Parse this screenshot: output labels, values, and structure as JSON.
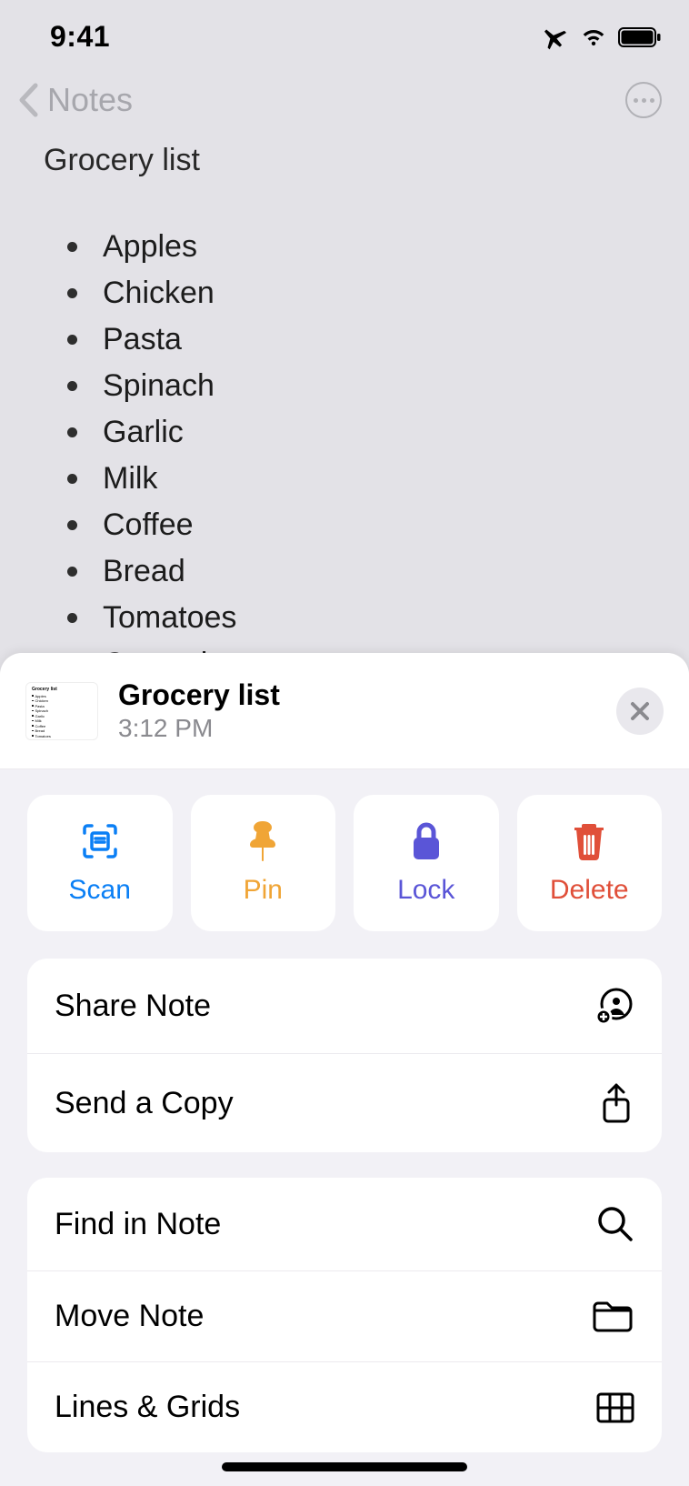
{
  "status": {
    "time": "9:41"
  },
  "nav": {
    "back_label": "Notes"
  },
  "note": {
    "title": "Grocery list",
    "items": [
      "Apples",
      "Chicken",
      "Pasta",
      "Spinach",
      "Garlic",
      "Milk",
      "Coffee",
      "Bread",
      "Tomatoes",
      "Cucumbers"
    ]
  },
  "sheet": {
    "title": "Grocery list",
    "subtitle": "3:12 PM",
    "quick": {
      "scan": "Scan",
      "pin": "Pin",
      "lock": "Lock",
      "delete": "Delete"
    },
    "menu1": {
      "share": "Share Note",
      "send": "Send a Copy"
    },
    "menu2": {
      "find": "Find in Note",
      "move": "Move Note",
      "lines": "Lines & Grids"
    }
  }
}
